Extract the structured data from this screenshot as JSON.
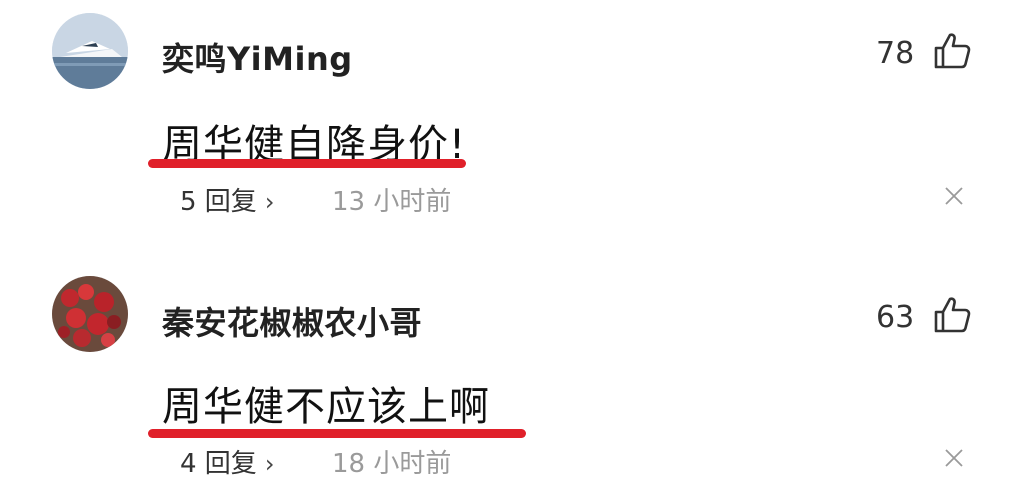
{
  "comments": [
    {
      "username": "奕鸣YiMing",
      "likes": "78",
      "content": "周华健自降身价!",
      "replies": "5 回复",
      "time": "13 小时前",
      "avatar_icon": "boat-avatar-icon"
    },
    {
      "username": "秦安花椒椒农小哥",
      "likes": "63",
      "content": "周华健不应该上啊",
      "replies": "4 回复",
      "time": "18 小时前",
      "avatar_icon": "pepper-avatar-icon"
    }
  ],
  "icons": {
    "like": "thumbs-up-icon",
    "more": "chevron-right-icon",
    "dismiss": "close-icon"
  },
  "colors": {
    "highlight_underline": "#e0202a",
    "timestamp": "#9a9a9a"
  }
}
